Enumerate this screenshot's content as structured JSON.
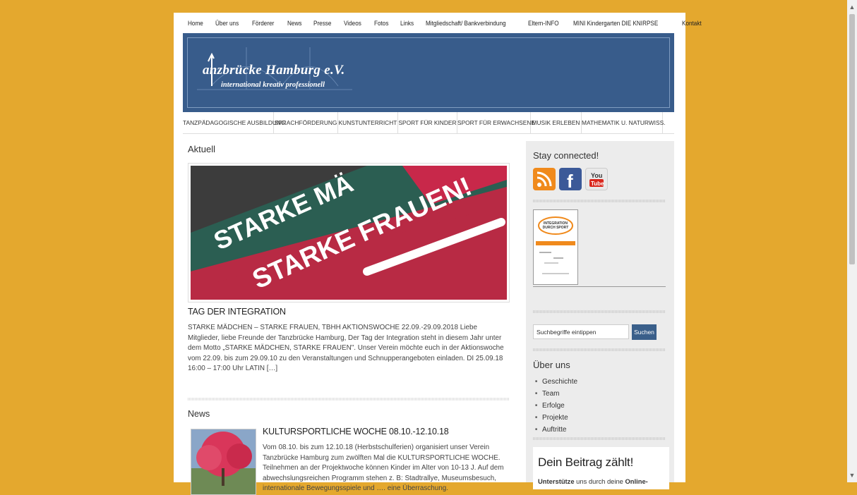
{
  "topnav": [
    "Home",
    "Über uns",
    "Förderer",
    "News",
    "Presse",
    "Videos",
    "Fotos",
    "Links",
    "Mitgliedschaft/ Bankverbindung",
    "Eltern-INFO",
    "MINI Kindergarten DIE KNIRPSE",
    "Kontakt"
  ],
  "banner": {
    "title": "anzbrücke Hamburg e.V.",
    "subtitle": "international kreativ professionell"
  },
  "catnav": [
    "TANZPÄDAGOGISCHE AUSBILDUNG",
    "SPRACHFÖRDERUNG",
    "KUNSTUNTERRICHT",
    "SPORT FÜR KINDER",
    "SPORT FÜR ERWACHSENE",
    "MUSIK ERLEBEN",
    "MATHEMATIK U. NATURWISS."
  ],
  "main": {
    "aktuell_title": "Aktuell",
    "feature_text1": "STARKE MÄ",
    "feature_text2": "STARKE FRAUEN!",
    "post_title": "TAG DER INTEGRATION",
    "excerpt": "STARKE MÄDCHEN – STARKE FRAUEN, TBHH AKTIONSWOCHE 22.09.-29.09.2018 Liebe Mitglieder, liebe Freunde der Tanzbrücke Hamburg, Der Tag der Integration steht in diesem Jahr unter dem Motto „STARKE MÄDCHEN, STARKE FRAUEN\". Unser Verein möchte euch in der Aktionswoche vom 22.09. bis zum 29.09.10 zu den Veranstaltungen und Schnupperangeboten einladen. DI 25.09.18 16:00 – 17:00 Uhr LATIN […]",
    "news_title": "News",
    "news_post_title": "KULTURSPORTLICHE WOCHE 08.10.-12.10.18",
    "news_text": "Vom 08.10. bis zum 12.10.18 (Herbstschulferien) organisiert unser Verein Tanzbrücke Hamburg zum zwölften Mal die KULTURSPORTLICHE WOCHE. Teilnehmen an der Projektwoche können Kinder im Alter von 10-13 J. Auf dem abwechslungsreichen Programm stehen z. B: Stadtrallye, Museumsbesuch, internationale Bewegungsspiele und …. eine Überraschung."
  },
  "sidebar": {
    "stay_title": "Stay connected!",
    "youtube_label": "You Tube",
    "badge_text": "INTEGRATION DURCH SPORT",
    "search_placeholder": "Suchbegriffe eintippen",
    "search_button": "Suchen",
    "about_title": "Über uns",
    "about_items": [
      "Geschichte",
      "Team",
      "Erfolge",
      "Projekte",
      "Auftritte"
    ],
    "donate_title": "Dein Beitrag zählt!",
    "donate_text_bold1": "Unterstütze",
    "donate_text_mid": " uns durch deine ",
    "donate_text_bold2": "Online-"
  },
  "colors": {
    "background": "#e4a82e",
    "banner": "#385c8b",
    "accent": "#3a5f8a"
  }
}
